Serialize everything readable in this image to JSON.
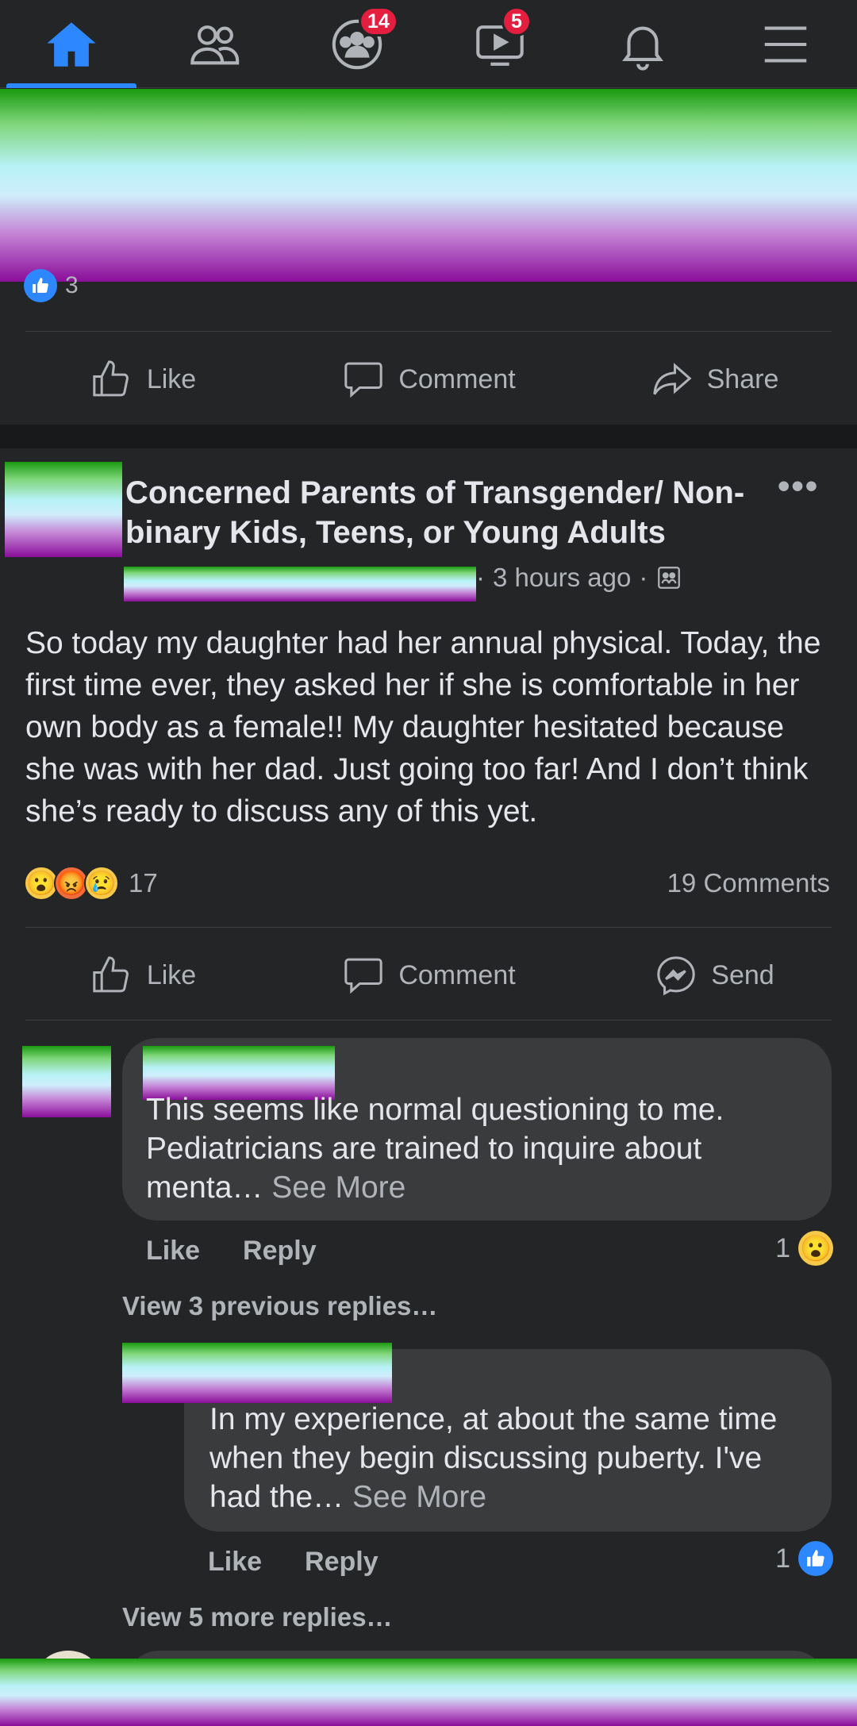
{
  "nav": {
    "items": [
      {
        "name": "home",
        "active": true
      },
      {
        "name": "friends"
      },
      {
        "name": "groups",
        "badge": "14"
      },
      {
        "name": "watch",
        "badge": "5"
      },
      {
        "name": "notifications"
      },
      {
        "name": "menu"
      }
    ]
  },
  "prev_post": {
    "reaction_count": "3",
    "actions": {
      "like": "Like",
      "comment": "Comment",
      "share": "Share"
    }
  },
  "post": {
    "group_name": "Concerned Parents of Transgender/ Non-binary Kids, Teens, or Young Adults",
    "time": "3 hours ago",
    "dot": "·",
    "body": "So today my daughter had her annual physical. Today, the first time ever, they asked her if she is comfortable in her own body as a female!! My daughter hesitated because she was with her dad. Just going too far! And I don’t think she’s ready to discuss any of this yet.",
    "reactions": {
      "emojis": [
        "😮",
        "😡",
        "😢"
      ],
      "count": "17"
    },
    "comments_count": "19 Comments",
    "actions": {
      "like": "Like",
      "comment": "Comment",
      "send": "Send"
    }
  },
  "comments": [
    {
      "text": "This seems like normal questioning to me. Pediatricians are trained to inquire about menta…",
      "see_more": "See More",
      "like": "Like",
      "reply": "Reply",
      "reaction_count": "1",
      "reaction_emoji": "😮",
      "view_replies": "View 3 previous replies…"
    },
    {
      "text": "In my experience, at about the same time when they begin discussing puberty. I've had the…",
      "see_more": "See More",
      "like": "Like",
      "reply": "Reply",
      "reaction_count": "1",
      "reaction_emoji": "like",
      "view_replies": "View 5 more replies…"
    }
  ],
  "colors": {
    "accent": "#2d88ff",
    "badge": "#e41e3f",
    "background": "#242526"
  }
}
